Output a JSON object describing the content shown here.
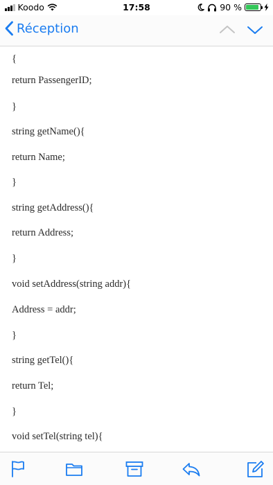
{
  "status_bar": {
    "carrier": "Koodo",
    "time": "17:58",
    "battery_percent_label": "90 %",
    "battery_level": 0.9,
    "colors": {
      "battery": "#34c759"
    },
    "icons": [
      "signal-bars-icon",
      "wifi-icon",
      "moon-icon",
      "headphones-icon",
      "battery-icon",
      "charging-bolt-icon"
    ]
  },
  "nav": {
    "back_label": "Réception",
    "icons": [
      "chevron-left-icon",
      "chevron-up-icon",
      "chevron-down-icon"
    ],
    "accent_color": "#1a7cf0"
  },
  "email_body": {
    "lines": [
      "{",
      "return PassengerID;",
      "}",
      "string getName(){",
      "return Name;",
      "}",
      "string getAddress(){",
      "return Address;",
      "}",
      "void setAddress(string addr){",
      "Address = addr;",
      "}",
      "string getTel(){",
      "return Tel;",
      "}",
      "void setTel(string tel){"
    ]
  },
  "toolbar": {
    "icons": [
      "flag-icon",
      "folder-icon",
      "archive-icon",
      "reply-icon",
      "compose-icon"
    ]
  }
}
